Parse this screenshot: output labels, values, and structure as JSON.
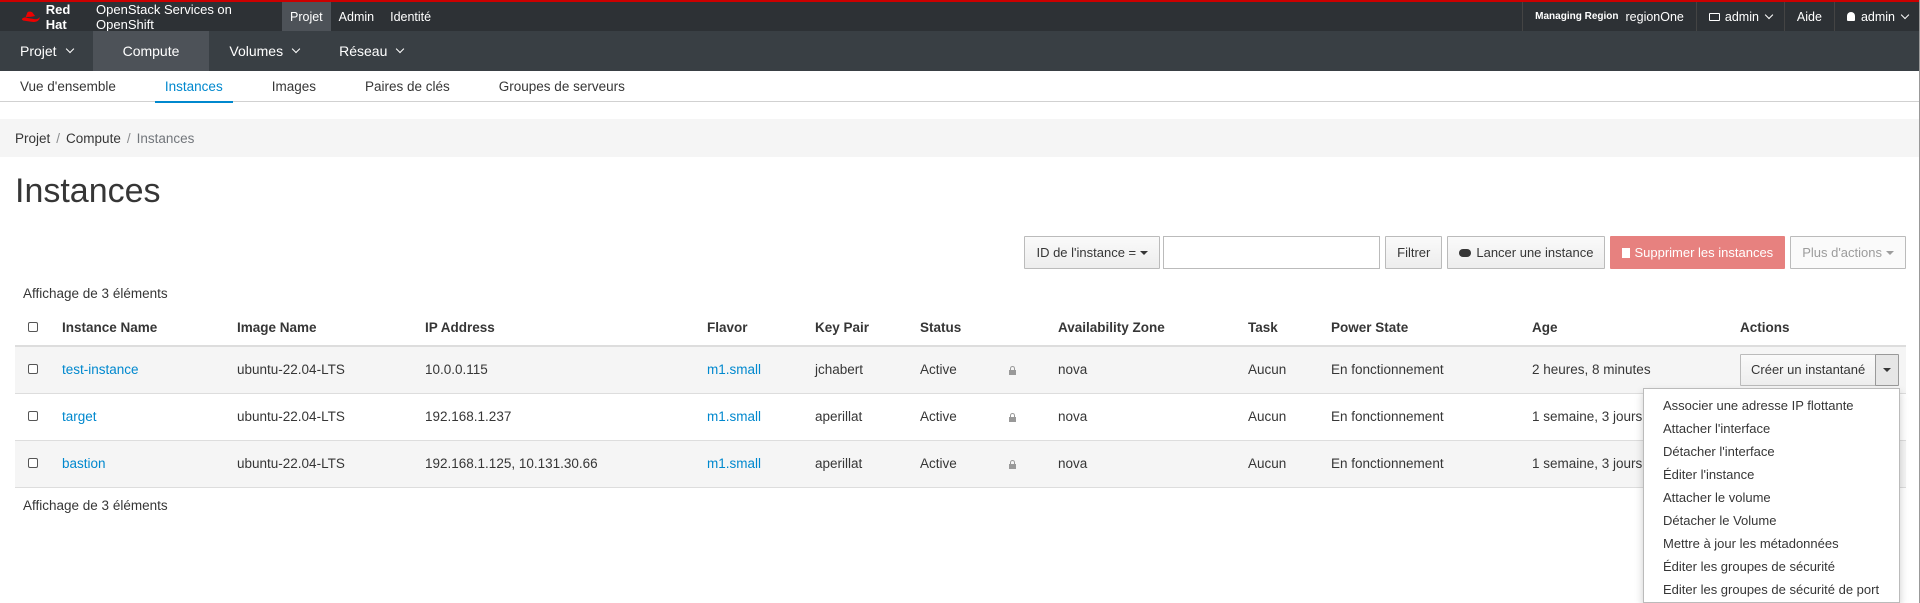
{
  "brand": {
    "logo": "Red Hat",
    "product": "OpenStack Services on OpenShift"
  },
  "topnav": [
    "Projet",
    "Admin",
    "Identité"
  ],
  "topright": {
    "region_label": "Managing Region",
    "region": "regionOne",
    "project": "admin",
    "help": "Aide",
    "user": "admin"
  },
  "secnav": [
    "Projet",
    "Compute",
    "Volumes",
    "Réseau"
  ],
  "tabs": [
    "Vue d'ensemble",
    "Instances",
    "Images",
    "Paires de clés",
    "Groupes de serveurs"
  ],
  "breadcrumb": [
    "Projet",
    "Compute",
    "Instances"
  ],
  "page_title": "Instances",
  "toolbar": {
    "filter_select": "ID de l'instance =",
    "filter_input_value": "",
    "filter_button": "Filtrer",
    "launch": "Lancer une instance",
    "delete": "Supprimer les instances",
    "more": "Plus d'actions"
  },
  "count_text": "Affichage de 3 éléments",
  "columns": [
    "Instance Name",
    "Image Name",
    "IP Address",
    "Flavor",
    "Key Pair",
    "Status",
    "Availability Zone",
    "Task",
    "Power State",
    "Age",
    "Actions"
  ],
  "rows": [
    {
      "name": "test-instance",
      "image": "ubuntu-22.04-LTS",
      "ip": "10.0.0.115",
      "flavor": "m1.small",
      "keypair": "jchabert",
      "status": "Active",
      "az": "nova",
      "task": "Aucun",
      "power": "En fonctionnement",
      "age": "2 heures, 8 minutes",
      "action": "Créer un instantané"
    },
    {
      "name": "target",
      "image": "ubuntu-22.04-LTS",
      "ip": "192.168.1.237",
      "flavor": "m1.small",
      "keypair": "aperillat",
      "status": "Active",
      "az": "nova",
      "task": "Aucun",
      "power": "En fonctionnement",
      "age": "1 semaine, 3 jours",
      "action": ""
    },
    {
      "name": "bastion",
      "image": "ubuntu-22.04-LTS",
      "ip": "192.168.1.125, 10.131.30.66",
      "flavor": "m1.small",
      "keypair": "aperillat",
      "status": "Active",
      "az": "nova",
      "task": "Aucun",
      "power": "En fonctionnement",
      "age": "1 semaine, 3 jours",
      "action": ""
    }
  ],
  "dropdown": [
    "Associer une adresse IP flottante",
    "Attacher l'interface",
    "Détacher l'interface",
    "Éditer l'instance",
    "Attacher le volume",
    "Détacher le Volume",
    "Mettre à jour les métadonnées",
    "Éditer les groupes de sécurité",
    "Editer les groupes de sécurité de port"
  ],
  "colors": {
    "accent": "#0088ce",
    "topbar": "#2d3135",
    "secnav": "#393f44",
    "danger": "#e7817f"
  }
}
